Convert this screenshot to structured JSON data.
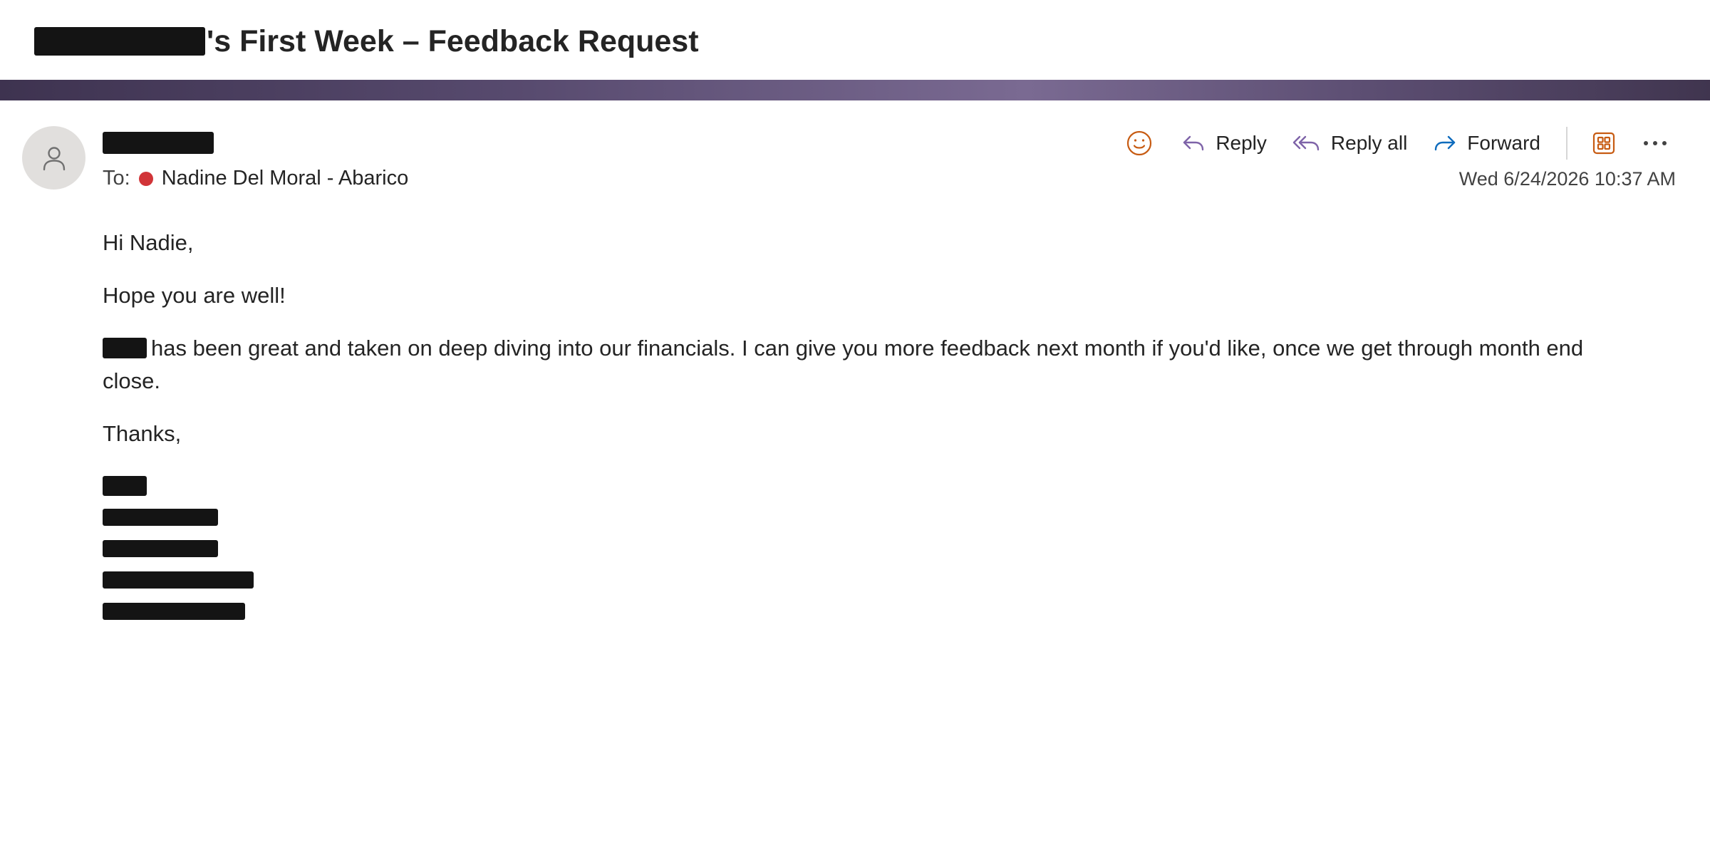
{
  "subject": {
    "text": "'s First Week – Feedback Request"
  },
  "sender": {
    "to_label": "To:",
    "recipient": "Nadine Del Moral - Abarico",
    "presence_color": "#d13438"
  },
  "toolbar": {
    "reply_label": "Reply",
    "reply_all_label": "Reply all",
    "forward_label": "Forward",
    "icons": [
      "emoji-icon",
      "reply-icon",
      "reply-all-icon",
      "forward-icon",
      "apps-icon",
      "more-icon"
    ]
  },
  "message": {
    "date": "Wed 6/24/2026 10:37 AM",
    "greeting": "Hi Nadie,",
    "line1": "Hope you are well!",
    "line2": "has been great and taken on deep diving into our financials. I can give you more feedback next month if you'd like, once we get through month end close.",
    "closing": "Thanks,"
  },
  "colors": {
    "accent_purple": "#7e63a8",
    "accent_blue": "#0f6cbd",
    "accent_orange": "#c75b12",
    "band": "#574a6e"
  }
}
